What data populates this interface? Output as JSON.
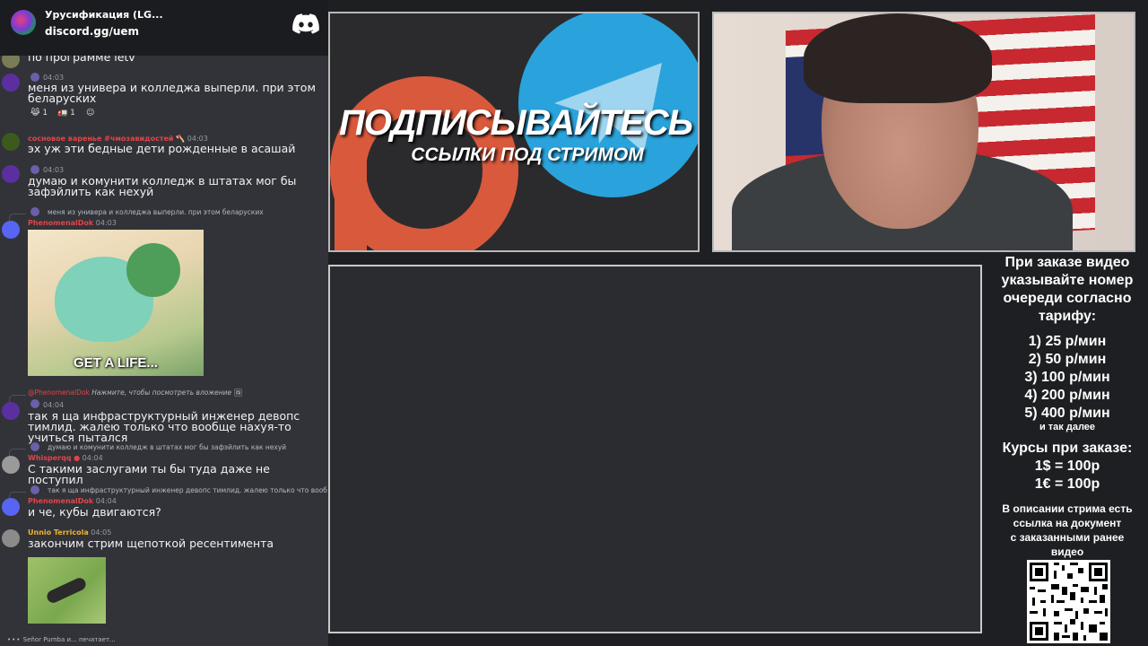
{
  "server": {
    "name": "Урусификация (LG...",
    "link": "discord.gg/uem"
  },
  "messages": {
    "m0": {
      "text": "по программе letv"
    },
    "m1": {
      "time": "04:03",
      "text": "меня из универа и колледжа выперли. при этом беларуских",
      "reactions": [
        {
          "emoji": "😹",
          "count": "1"
        },
        {
          "emoji": "🚛",
          "count": "1"
        },
        {
          "emoji": "☺",
          "count": ""
        }
      ]
    },
    "m2": {
      "user": "сосновое варенье #чмозавидостей 🪓",
      "time": "04:03",
      "text": "эх уж эти бедные дети рожденные в асашай"
    },
    "m3": {
      "time": "04:03",
      "text": "думаю и комунити колледж в штатах мог бы зафэйлить как нехуй"
    },
    "m4": {
      "reply": "меня из универа и колледжа выперли. при этом беларуских",
      "user": "PhenomenalDok",
      "time": "04:03",
      "image_caption": "GET A LIFE..."
    },
    "m5": {
      "reply_user": "@PhenomenalDok",
      "reply": "Нажмите, чтобы посмотреть вложение",
      "time": "04:04",
      "text": "так я ща инфраструктурный инженер девопс тимлид. жалею только что вообще нахуя-то учиться пытался"
    },
    "m6": {
      "reply": "думаю и комунити колледж в штатах мог бы зафэйлить как нехуй",
      "user": "Whisperqq",
      "time": "04:04",
      "text": "С такими заслугами ты бы туда даже не поступил"
    },
    "m7": {
      "reply": "так я ща инфраструктурный инженер девопс тимлид. жалею только что вообще нахуя-то учиться пытался",
      "user": "PhenomenalDok",
      "time": "04:04",
      "text": "и че, кубы двигаются?"
    },
    "m8": {
      "user": "Unnio Terricola",
      "time": "04:05",
      "text": "закончим стрим щепоткой ресентимента"
    }
  },
  "typing": "Señor Pumba и... печатает...",
  "promo": {
    "headline": "ПОДПИСЫВАЙТЕСЬ",
    "subline": "ССЫЛКИ ПОД СТРИМОМ"
  },
  "info": {
    "line1": "При заказе видео",
    "line2": "указывайте номер",
    "line3": "очереди согласно",
    "line4": "тарифу:",
    "tariffs": [
      "1) 25 р/мин",
      "2) 50 р/мин",
      "3) 100 р/мин",
      "4) 200 р/мин",
      "5) 400 р/мин"
    ],
    "etc": "и так далее",
    "rates_title": "Курсы при заказе:",
    "rate_usd": "1$ = 100р",
    "rate_eur": "1€ = 100р",
    "desc1": "В описании стрима есть",
    "desc2": "ссылка на документ",
    "desc3": "с заказанными ранее",
    "desc4": "видео"
  },
  "colors": {
    "chat_bg": "#313338",
    "discord_blurple": "#5865f2",
    "patreon_orange": "#d9593c",
    "telegram_blue": "#2aa3dc",
    "username_red": "#e0454a"
  }
}
